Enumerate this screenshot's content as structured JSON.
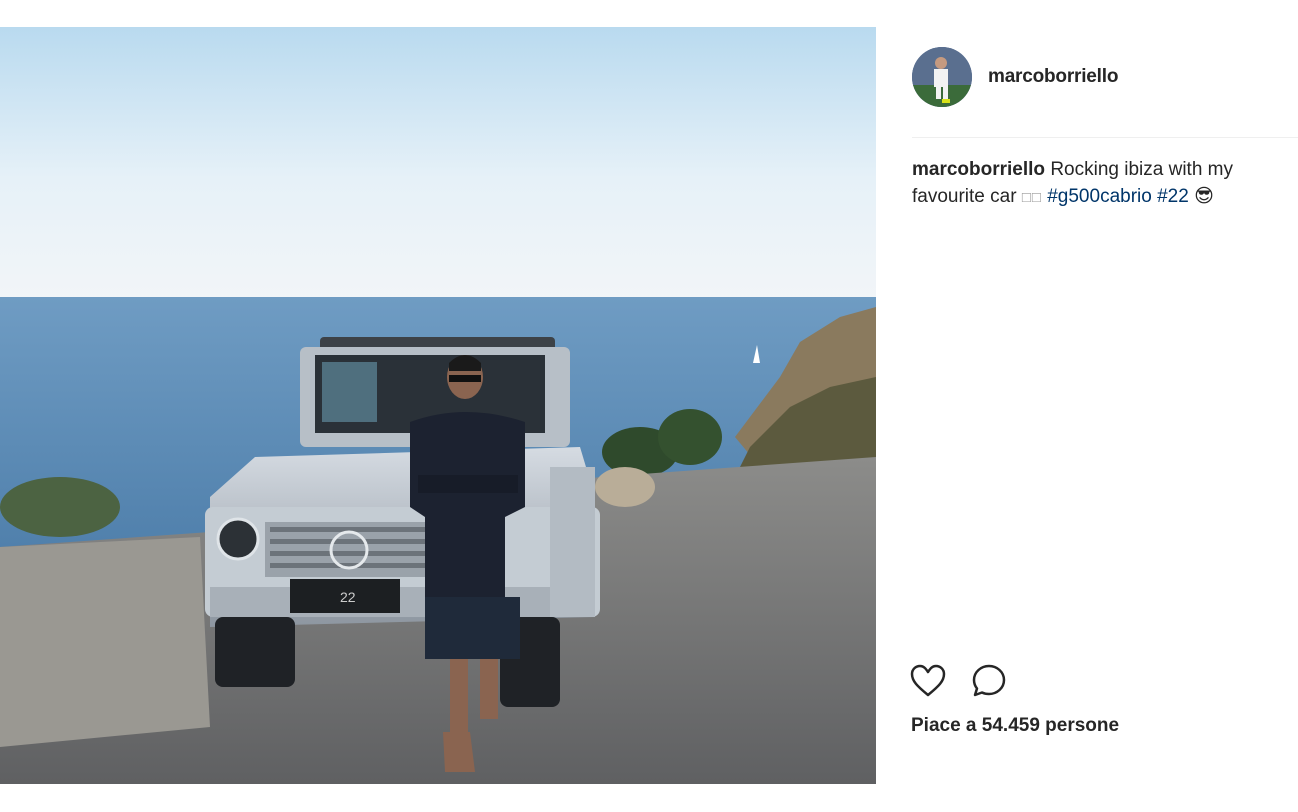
{
  "post": {
    "username": "marcoborriello",
    "caption": {
      "username": "marcoborriello",
      "text": "Rocking ibiza with my favourite car",
      "unrendered_glyphs": "□□",
      "hashtags": [
        "#g500cabrio",
        "#22"
      ],
      "emoji": "😎"
    },
    "likes_text": "Piace a 54.459 persone",
    "photo": {
      "description_icon": "photo-icon",
      "plate_text": "22"
    }
  },
  "colors": {
    "text": "#262626",
    "hashtag": "#003569",
    "divider": "#efefef"
  },
  "icons": {
    "like": "heart-icon",
    "comment": "comment-icon"
  }
}
